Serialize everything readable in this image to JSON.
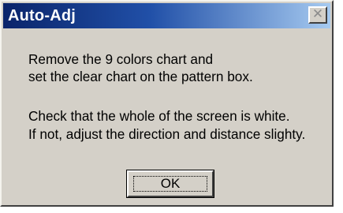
{
  "window": {
    "title": "Auto-Adj",
    "close_icon": "close-icon"
  },
  "message": {
    "line1": "Remove the 9 colors chart and",
    "line2": "set the clear chart on the pattern box.",
    "line3": "Check that the whole of the screen is white.",
    "line4": "If not, adjust the direction and distance slighty."
  },
  "buttons": {
    "ok_label": "OK"
  },
  "colors": {
    "title_bar_start": "#0a246a",
    "title_bar_end": "#a6caf0",
    "dialog_face": "#d4d0c8"
  }
}
